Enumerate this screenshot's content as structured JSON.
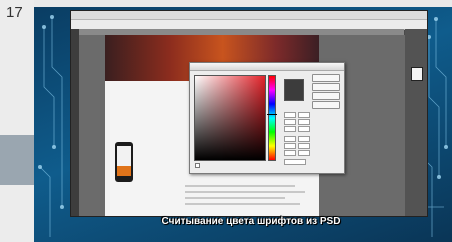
{
  "slide": {
    "number": "17",
    "caption": "Считывание цвета шрифтов из PSD"
  },
  "colors": {
    "slide_bg": "#0f5c8c",
    "hero_accent": "#c8541e",
    "picked_color": "#3c3c3c"
  },
  "icons": [
    "circuit-pattern",
    "photoshop-window",
    "color-picker-dialog",
    "phone-mockup"
  ]
}
